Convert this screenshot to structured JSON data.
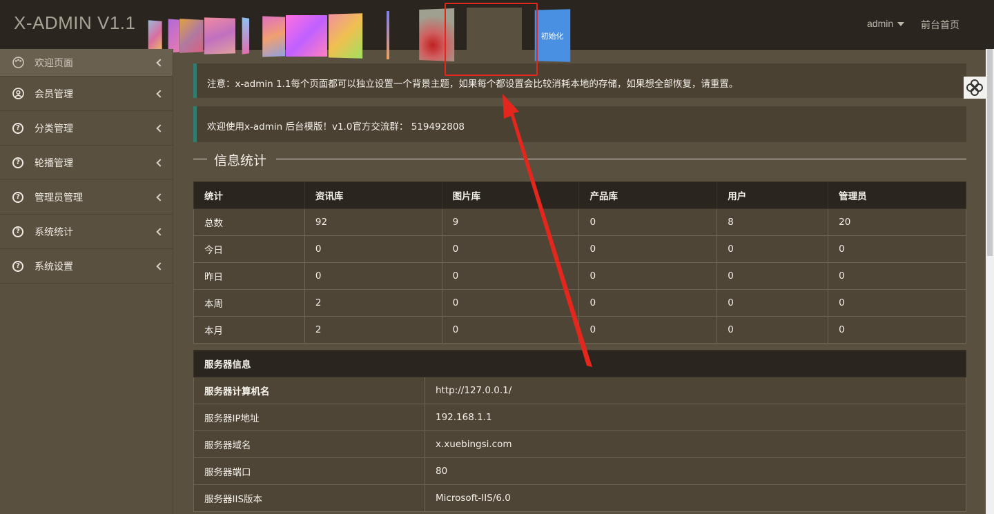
{
  "header": {
    "logo": "X-ADMIN V1.1",
    "reset_label": "初始化",
    "user": "admin",
    "home_link": "前台首页"
  },
  "sidebar": {
    "items": [
      {
        "label": "欢迎页面",
        "icon": "palette-icon"
      },
      {
        "label": "会员管理",
        "icon": "user-circle-icon"
      },
      {
        "label": "分类管理",
        "icon": "question-circle-icon"
      },
      {
        "label": "轮播管理",
        "icon": "question-circle-icon"
      },
      {
        "label": "管理员管理",
        "icon": "question-circle-icon"
      },
      {
        "label": "系统统计",
        "icon": "question-circle-icon"
      },
      {
        "label": "系统设置",
        "icon": "question-circle-icon"
      }
    ]
  },
  "notice": "注意：x-admin 1.1每个页面都可以独立设置一个背景主题，如果每个都设置会比较消耗本地的存储，如果想全部恢复，请重置。",
  "welcome": "欢迎使用x-admin 后台模版！v1.0官方交流群： 519492808",
  "section_title": "信息统计",
  "stats": {
    "headers": [
      "统计",
      "资讯库",
      "图片库",
      "产品库",
      "用户",
      "管理员"
    ],
    "rows": [
      [
        "总数",
        "92",
        "9",
        "0",
        "8",
        "20"
      ],
      [
        "今日",
        "0",
        "0",
        "0",
        "0",
        "0"
      ],
      [
        "昨日",
        "0",
        "0",
        "0",
        "0",
        "0"
      ],
      [
        "本周",
        "2",
        "0",
        "0",
        "0",
        "0"
      ],
      [
        "本月",
        "2",
        "0",
        "0",
        "0",
        "0"
      ]
    ]
  },
  "server": {
    "title": "服务器信息",
    "rows": [
      [
        "服务器计算机名",
        "http://127.0.0.1/"
      ],
      [
        "服务器IP地址",
        "192.168.1.1"
      ],
      [
        "服务器域名",
        "x.xuebingsi.com"
      ],
      [
        "服务器端口",
        "80"
      ],
      [
        "服务器IIS版本",
        "Microsoft-IIS/6.0"
      ]
    ]
  },
  "colors": {
    "theme_bg": "#5a5040",
    "header_bg": "#2a251e",
    "accent_border": "#2e7d6e",
    "annotation_red": "#e4261c"
  }
}
